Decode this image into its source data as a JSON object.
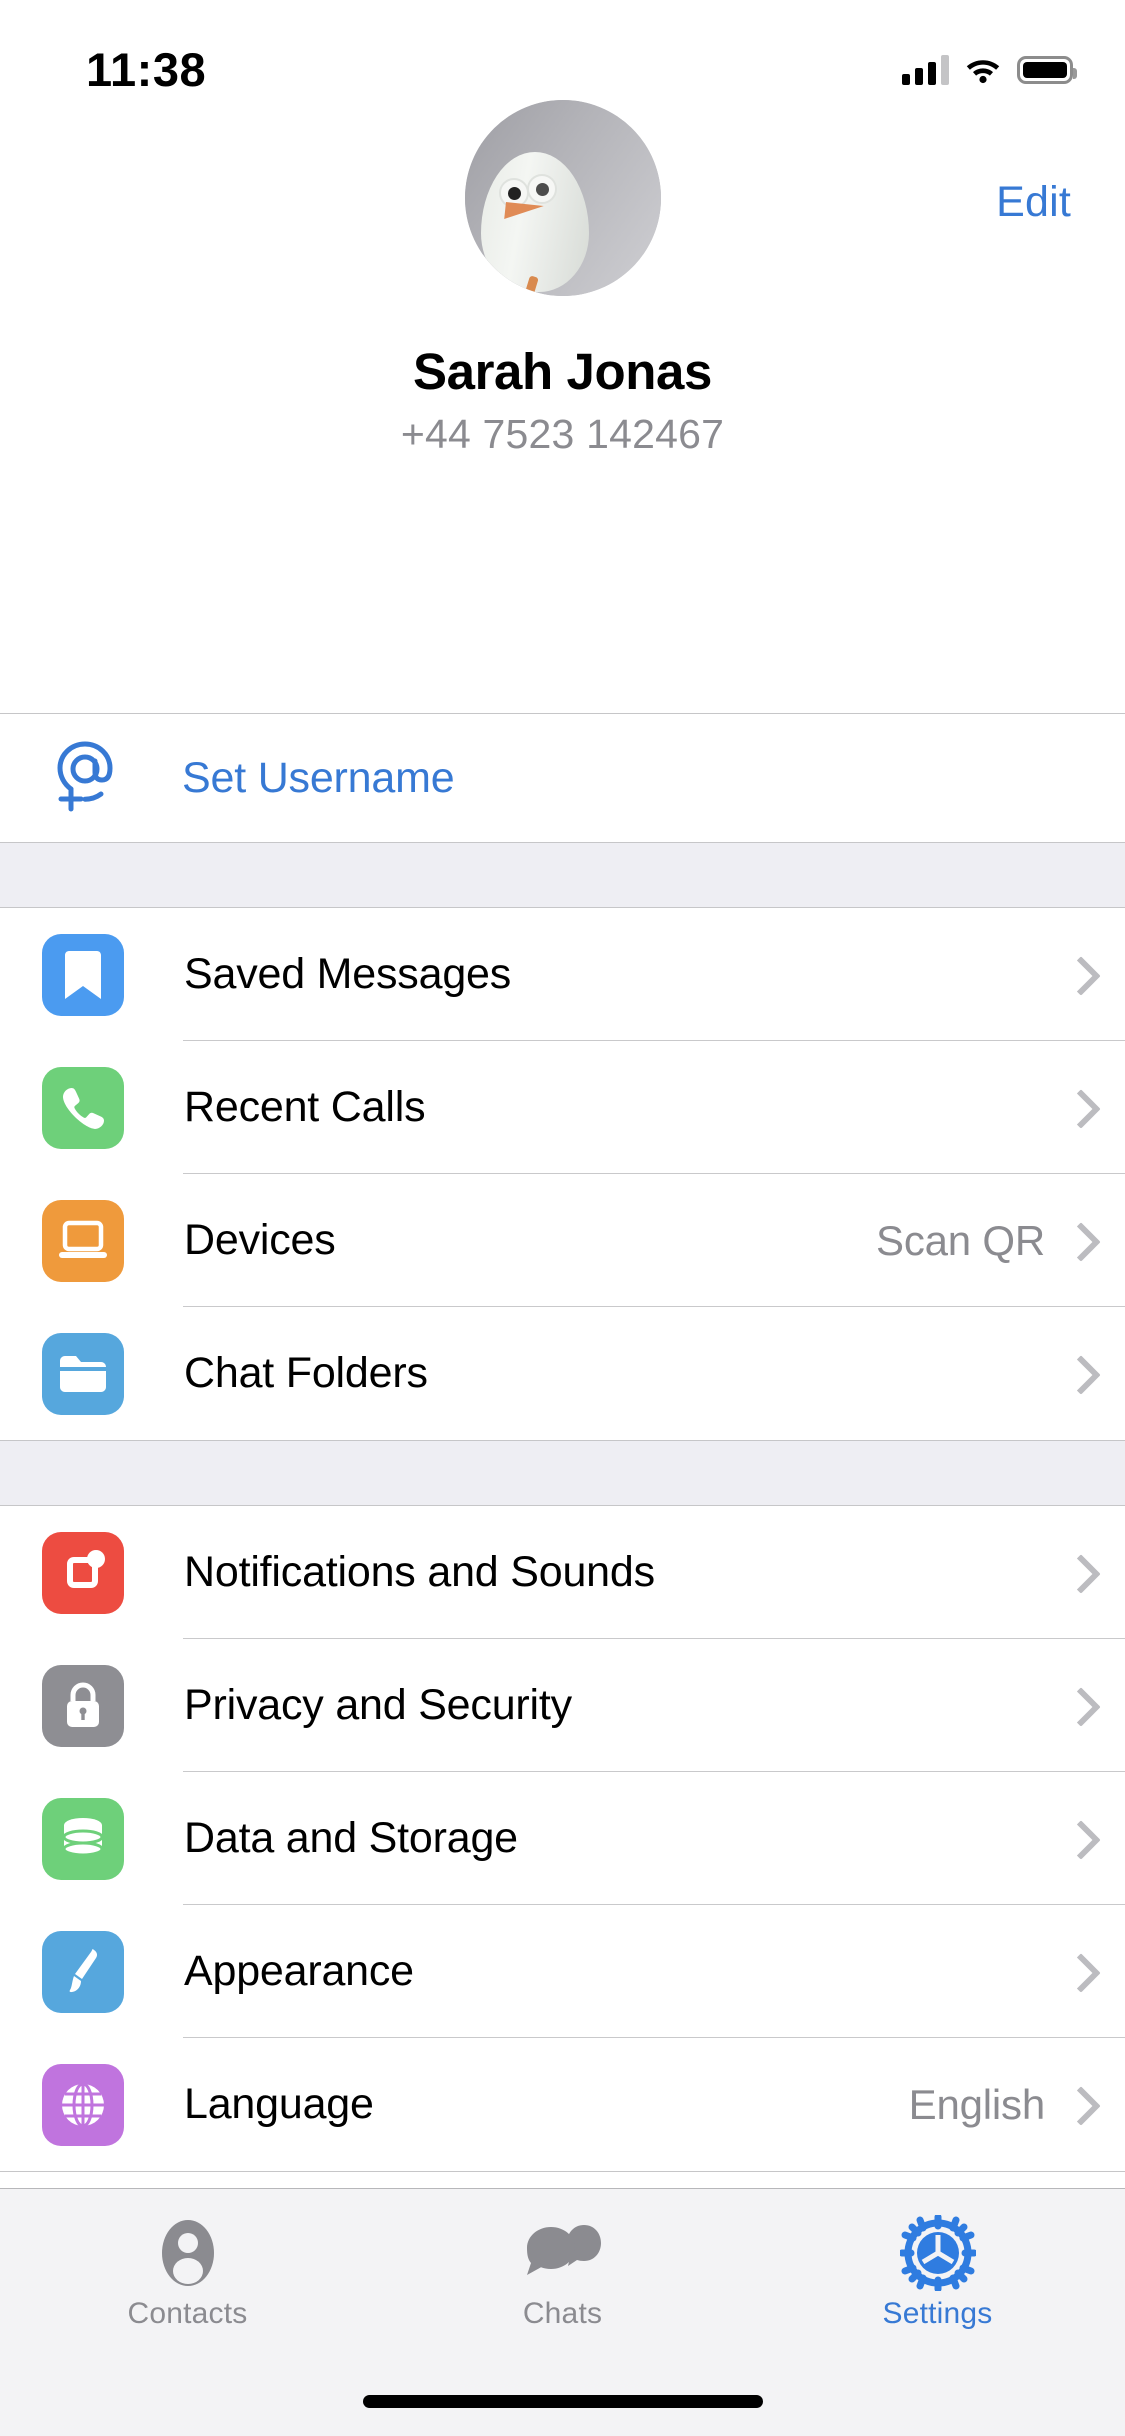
{
  "status_bar": {
    "time": "11:38",
    "signal_icon": "cellular-bars-icon",
    "wifi_icon": "wifi-icon",
    "battery_icon": "battery-icon"
  },
  "header": {
    "edit_label": "Edit"
  },
  "profile": {
    "avatar_icon": "user-avatar-photo",
    "name": "Sarah Jonas",
    "phone": "+44 7523 142467"
  },
  "sections": [
    {
      "id": "username-section",
      "rows": [
        {
          "label": "Set Username",
          "icon": "at-sign-plus-icon",
          "icon_color": "#3779d4",
          "style": "link",
          "value": "",
          "chevron": false
        }
      ]
    },
    {
      "id": "account-section",
      "rows": [
        {
          "label": "Saved Messages",
          "icon": "bookmark-icon",
          "icon_color": "#4b9bf0",
          "style": "normal",
          "value": "",
          "chevron": true
        },
        {
          "label": "Recent Calls",
          "icon": "phone-icon",
          "icon_color": "#6ed07a",
          "style": "normal",
          "value": "",
          "chevron": true
        },
        {
          "label": "Devices",
          "icon": "laptop-icon",
          "icon_color": "#ef9a3c",
          "style": "normal",
          "value": "Scan QR",
          "chevron": true
        },
        {
          "label": "Chat Folders",
          "icon": "folder-icon",
          "icon_color": "#56a7dd",
          "style": "normal",
          "value": "",
          "chevron": true
        }
      ]
    },
    {
      "id": "settings-section",
      "rows": [
        {
          "label": "Notifications and Sounds",
          "icon": "notification-badge-icon",
          "icon_color": "#ed4c41",
          "style": "normal",
          "value": "",
          "chevron": true
        },
        {
          "label": "Privacy and Security",
          "icon": "lock-icon",
          "icon_color": "#8e8e93",
          "style": "normal",
          "value": "",
          "chevron": true
        },
        {
          "label": "Data and Storage",
          "icon": "database-icon",
          "icon_color": "#6ed07a",
          "style": "normal",
          "value": "",
          "chevron": true
        },
        {
          "label": "Appearance",
          "icon": "paintbrush-icon",
          "icon_color": "#56a7dd",
          "style": "normal",
          "value": "",
          "chevron": true
        },
        {
          "label": "Language",
          "icon": "globe-icon",
          "icon_color": "#c074de",
          "style": "normal",
          "value": "English",
          "chevron": true
        }
      ]
    }
  ],
  "tab_bar": {
    "tabs": [
      {
        "label": "Contacts",
        "icon": "person-icon",
        "active": false
      },
      {
        "label": "Chats",
        "icon": "chat-bubbles-icon",
        "active": false
      },
      {
        "label": "Settings",
        "icon": "gear-icon",
        "active": true
      }
    ]
  },
  "colors": {
    "accent_blue": "#3779d4",
    "secondary_text": "#8b8b90",
    "group_background": "#eeeef3",
    "tabbar_background": "#f3f3f5"
  }
}
